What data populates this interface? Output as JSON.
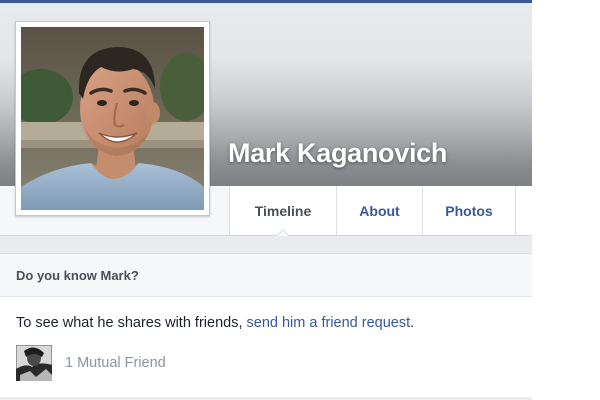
{
  "profile": {
    "name": "Mark Kaganovich"
  },
  "tabs": [
    {
      "label": "Timeline"
    },
    {
      "label": "About"
    },
    {
      "label": "Photos"
    }
  ],
  "know_card": {
    "title": "Do you know Mark?",
    "text_before": "To see what he shares with friends, ",
    "link_text": "send him a friend request",
    "text_after": ".",
    "mutual_label": "1 Mutual Friend"
  },
  "colors": {
    "brand_blue": "#3b5998",
    "link_blue": "#365899",
    "muted_text": "#8d949e",
    "page_bg": "#e9ebee"
  },
  "icons": {
    "profile_photo": "person-portrait",
    "mutual_friend_photo": "friend-avatar"
  }
}
